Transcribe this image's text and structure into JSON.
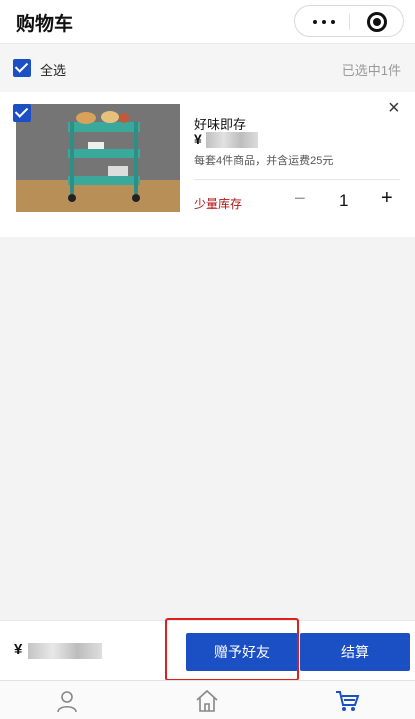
{
  "header": {
    "title": "购物车"
  },
  "select_all": {
    "label": "全选",
    "count_text": "已选中1件"
  },
  "cart_item": {
    "name": "好味即存",
    "price_symbol": "¥",
    "description": "每套4件商品，并含运费25元",
    "stock_status": "少量库存",
    "quantity": "1",
    "minus_label": "−",
    "plus_label": "+",
    "remove_label": "×"
  },
  "checkout": {
    "total_symbol": "¥",
    "gift_button": "赠予好友",
    "pay_button": "结算"
  },
  "colors": {
    "accent": "#1b4fc4",
    "stock_text": "#b01515",
    "highlight": "#e01e1e"
  },
  "tabbar": {
    "icons": [
      "user-icon",
      "home-icon",
      "cart-icon"
    ]
  }
}
